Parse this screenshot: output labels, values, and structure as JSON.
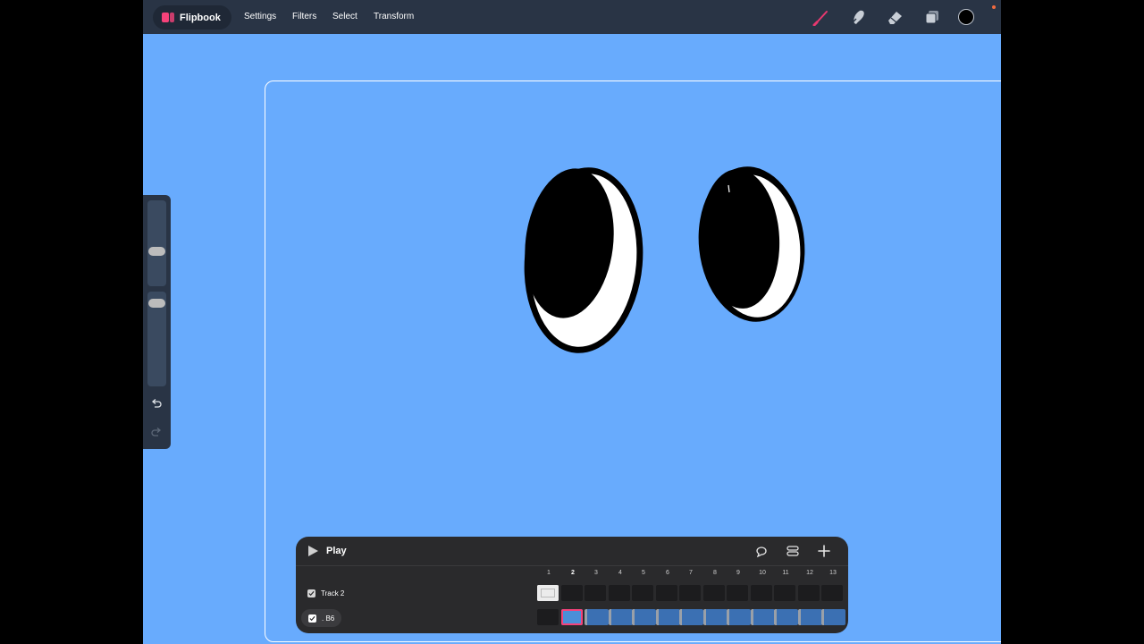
{
  "app": {
    "name": "Flipbook"
  },
  "menu": {
    "settings": "Settings",
    "filters": "Filters",
    "select": "Select",
    "transform": "Transform"
  },
  "tools": [
    "brush-icon",
    "smudge-icon",
    "eraser-icon",
    "layers-icon",
    "color-swatch"
  ],
  "colors": {
    "accent": "#f5427a",
    "canvas_bg": "#68abfd",
    "toolbar": "#293445",
    "current_color": "#000000"
  },
  "timeline": {
    "play_label": "Play",
    "frame_numbers": [
      "1",
      "2",
      "3",
      "4",
      "5",
      "6",
      "7",
      "8",
      "9",
      "10",
      "11",
      "12",
      "13"
    ],
    "current_frame": "2",
    "tracks": [
      {
        "name": "Track 2",
        "visible": true
      },
      {
        "name": ". B6",
        "visible": true
      }
    ]
  }
}
